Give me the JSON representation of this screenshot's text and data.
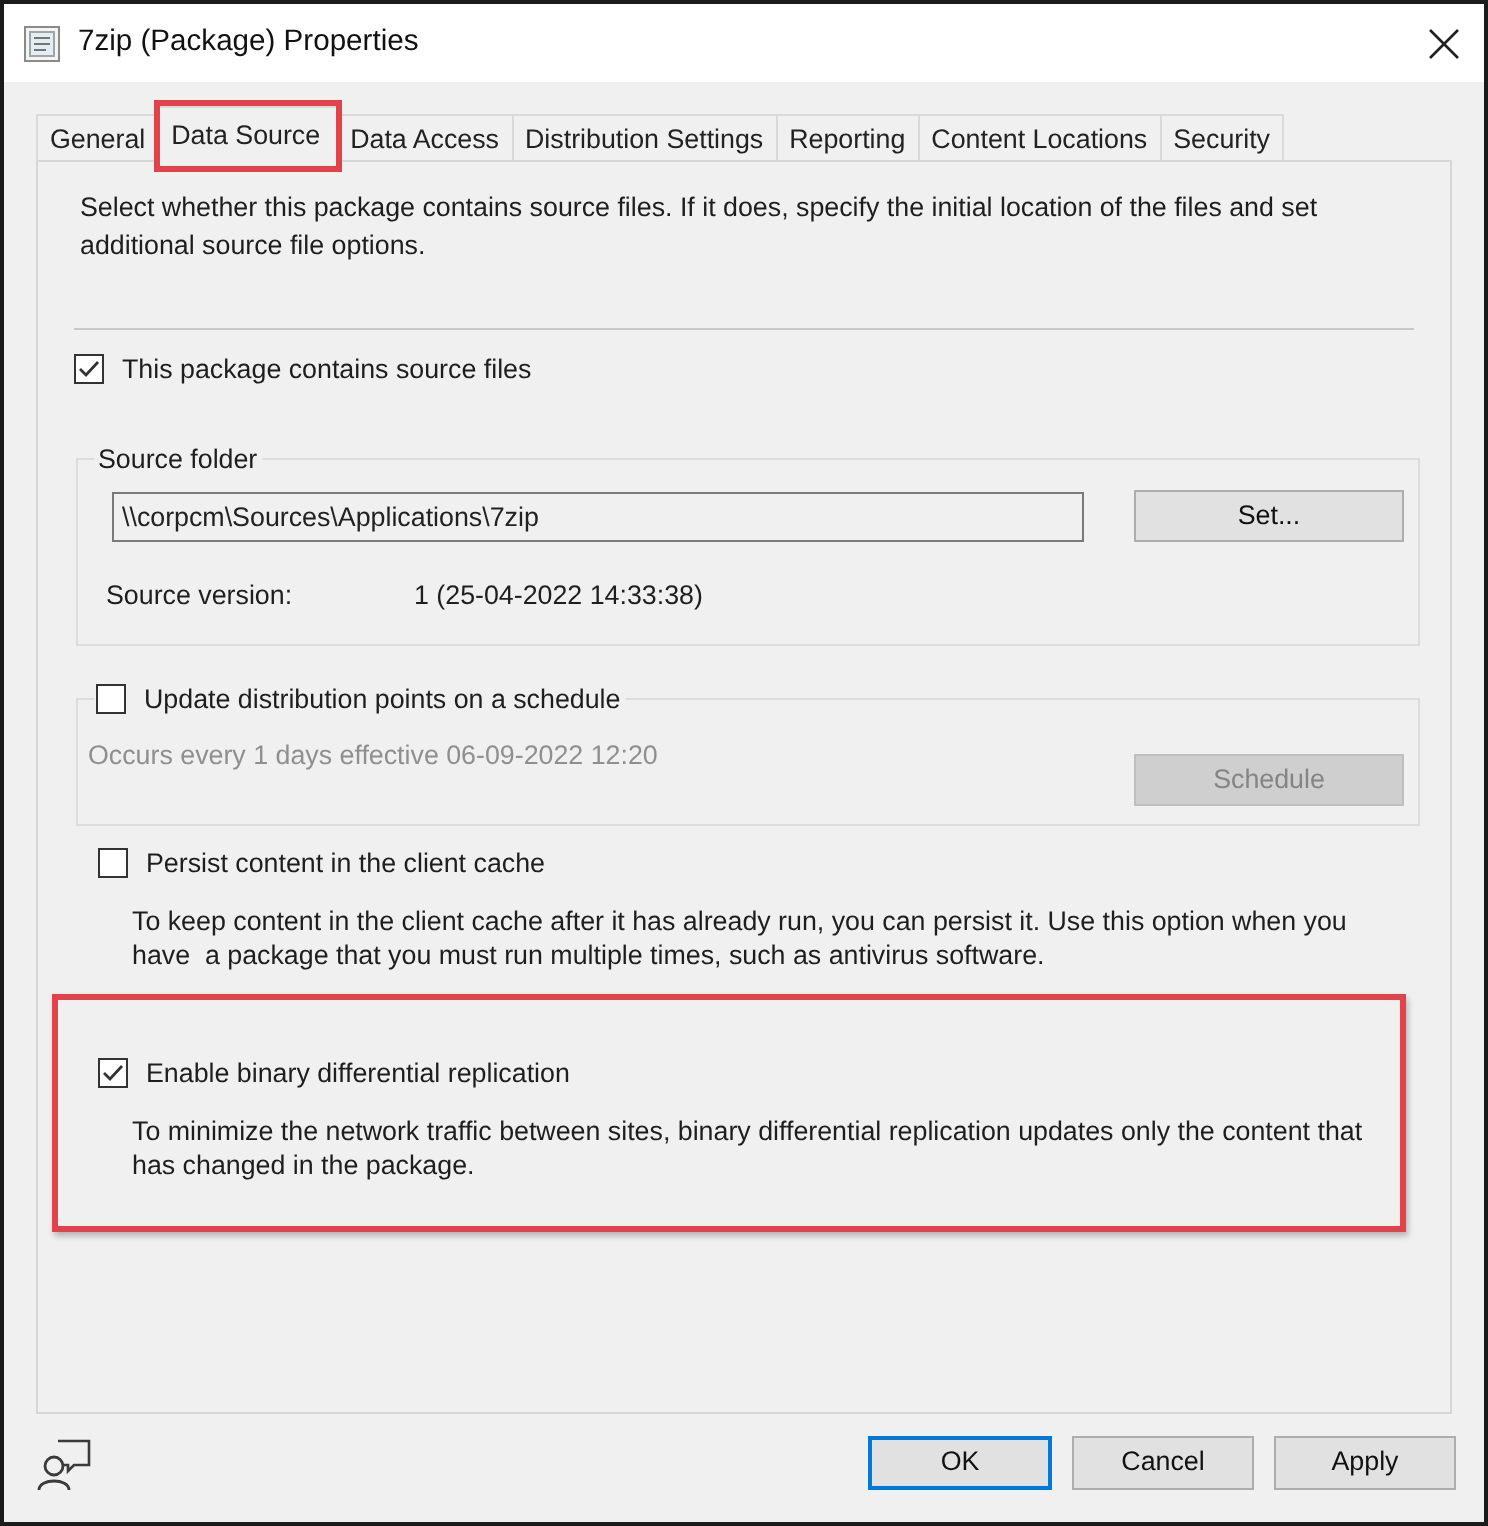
{
  "window": {
    "title": "7zip (Package) Properties"
  },
  "tabs": [
    {
      "label": "General",
      "selected": false,
      "highlighted": false
    },
    {
      "label": "Data Source",
      "selected": true,
      "highlighted": true
    },
    {
      "label": "Data Access",
      "selected": false,
      "highlighted": false
    },
    {
      "label": "Distribution Settings",
      "selected": false,
      "highlighted": false
    },
    {
      "label": "Reporting",
      "selected": false,
      "highlighted": false
    },
    {
      "label": "Content Locations",
      "selected": false,
      "highlighted": false
    },
    {
      "label": "Security",
      "selected": false,
      "highlighted": false
    }
  ],
  "data_source": {
    "description": "Select whether this package contains source files. If it does, specify the initial location of the files and set additional source file options.",
    "contains_source": {
      "label": "This package contains source files",
      "checked": true
    },
    "source_folder": {
      "title": "Source folder",
      "path": "\\\\corpcm\\Sources\\Applications\\7zip",
      "button": "Set...",
      "version_label": "Source version:",
      "version": "1 (25-04-2022 14:33:38)"
    },
    "schedule": {
      "label": "Update distribution points on a schedule",
      "checked": false,
      "summary": "Occurs every 1 days effective 06-09-2022 12:20",
      "button": {
        "label": "Schedule",
        "disabled": true
      }
    },
    "options": [
      {
        "label": "Persist content in the client cache",
        "checked": false,
        "highlighted": false,
        "description": "To keep content in the client cache after it has already run, you can persist it. Use this option when you have  a package that you must run multiple times, such as antivirus software."
      },
      {
        "label": "Enable binary differential replication",
        "checked": true,
        "highlighted": true,
        "description": "To minimize the network traffic between sites, binary differential replication updates only the content that has changed in the package."
      }
    ]
  },
  "buttons": [
    {
      "label": "OK",
      "default": true
    },
    {
      "label": "Cancel",
      "default": false
    },
    {
      "label": "Apply",
      "default": false
    }
  ]
}
